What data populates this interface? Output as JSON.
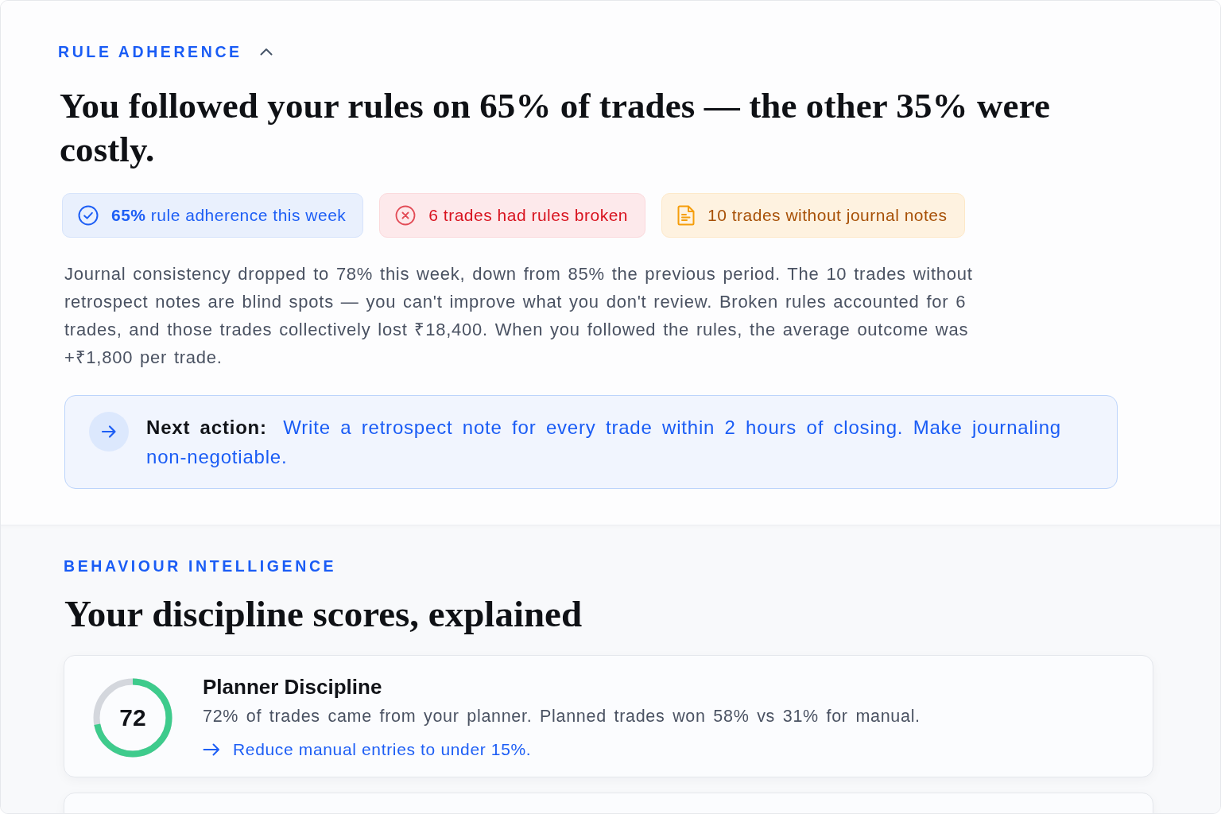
{
  "rule_adherence": {
    "eyebrow": "RULE ADHERENCE",
    "expanded": true,
    "headline": "You followed your rules on 65% of trades — the other 35% were costly.",
    "chips": [
      {
        "kind": "success",
        "text": "**65%** rule adherence this week"
      },
      {
        "kind": "danger",
        "text": "6 trades had rules broken"
      },
      {
        "kind": "warning",
        "text": "10 trades without journal notes"
      }
    ],
    "summary": "Journal consistency dropped to 78% this week, down from 85% the previous period. The 10 trades without retrospect notes are blind spots — you can't improve what you don't review. Broken rules accounted for 6 trades, and those trades collectively lost ₹18,400. When you followed the rules, the average outcome was +₹1,800 per trade.",
    "next_action": "**Next action:** Write a retrospect note for every trade within 2 hours of closing. Make journaling non-negotiable."
  },
  "behaviour_intelligence": {
    "eyebrow": "BEHAVIOUR INTELLIGENCE",
    "headline": "Your discipline scores, explained",
    "scores": [
      {
        "title": "Planner Discipline",
        "score": "72",
        "level": 0.72,
        "description": "72% of trades came from your planner. Planned trades won 58% vs 31% for manual.",
        "action": "Reduce manual entries to under 15%."
      }
    ]
  }
}
